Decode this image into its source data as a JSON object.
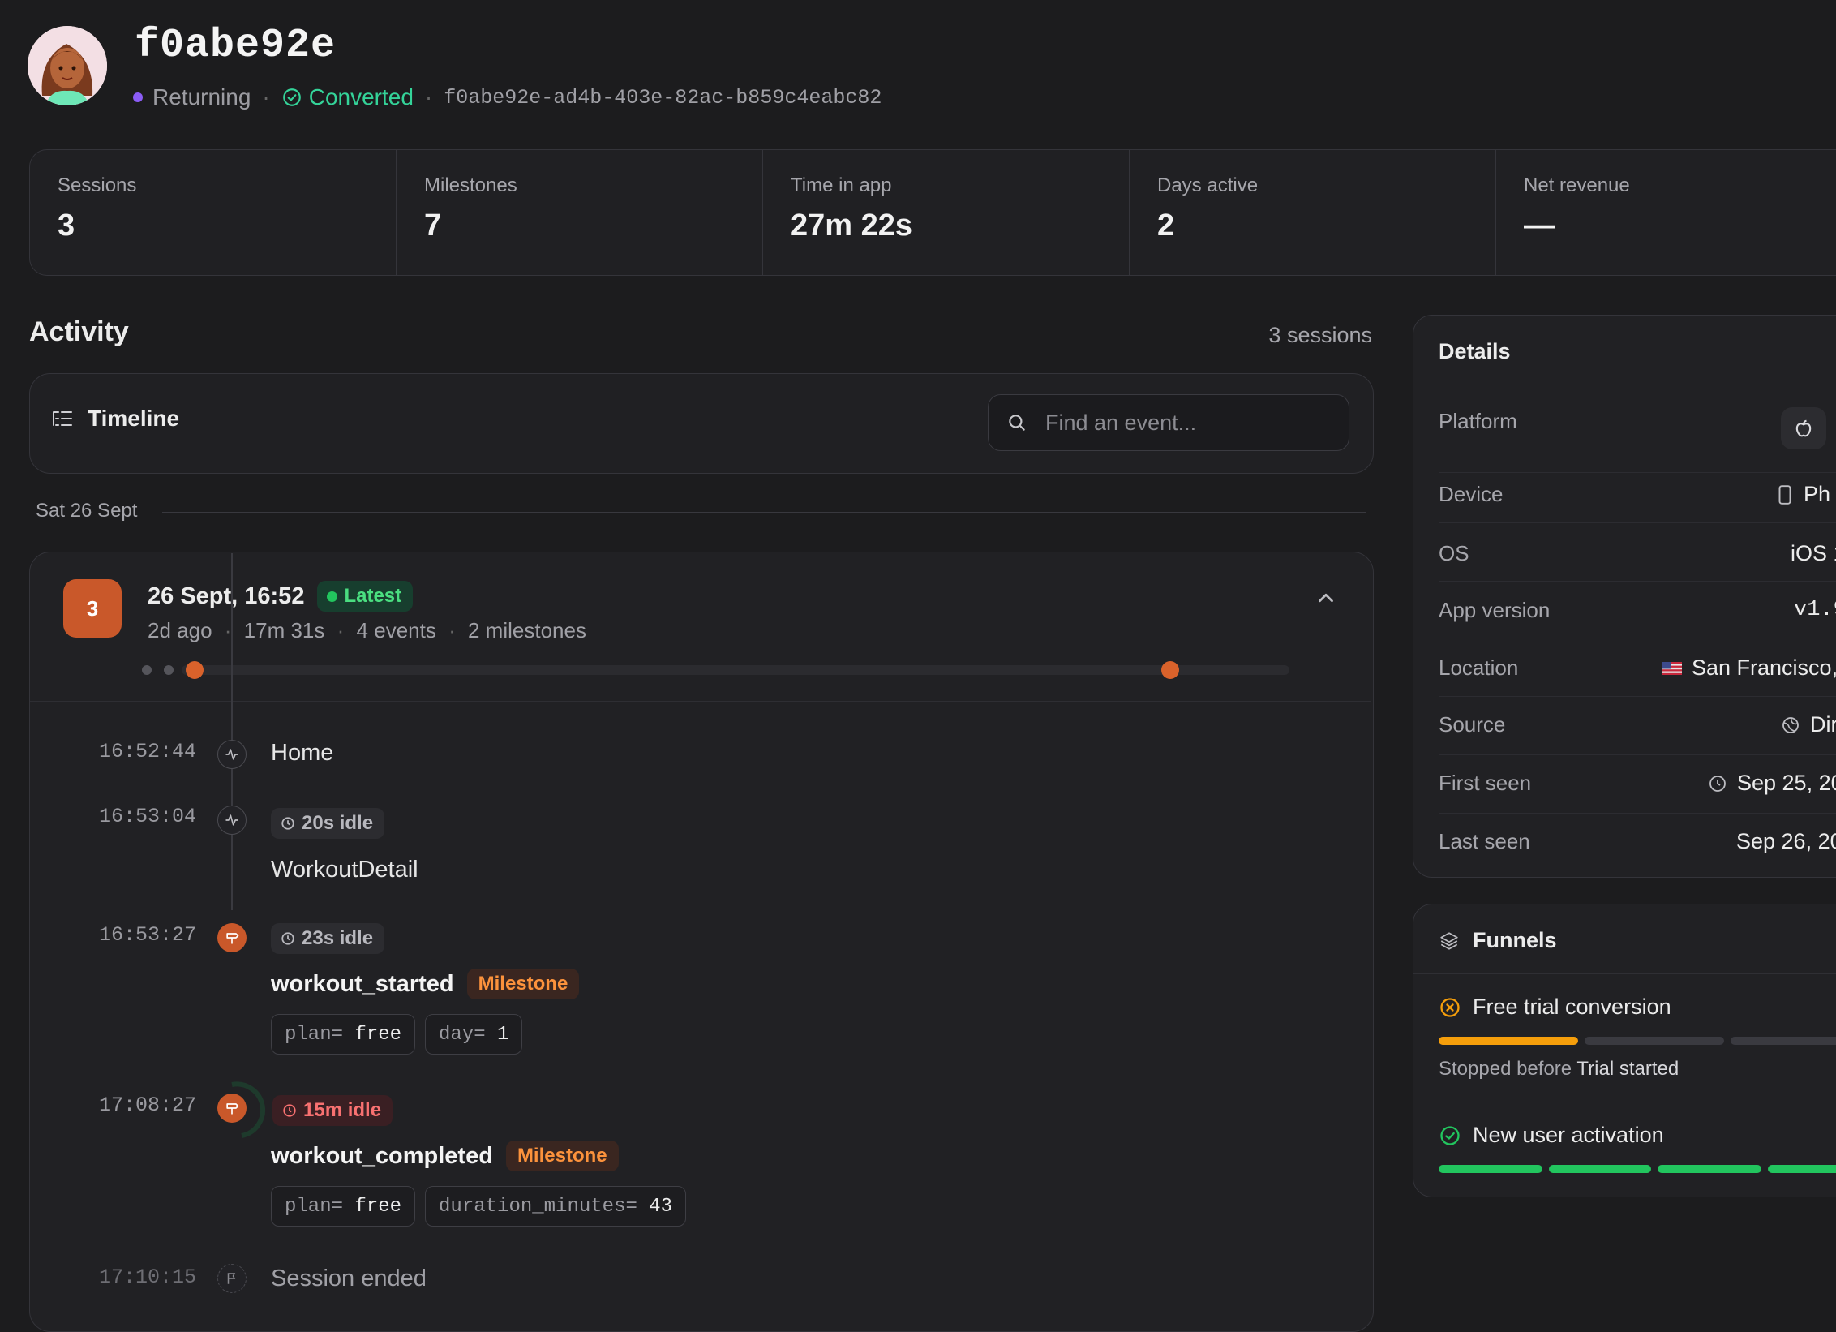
{
  "header": {
    "user_id": "f0abe92e",
    "status": "Returning",
    "conversion": "Converted",
    "uuid": "f0abe92e-ad4b-403e-82ac-b859c4eabc82",
    "status_dot_color": "#8b5cf6",
    "conversion_color": "#34d399"
  },
  "stats": [
    {
      "label": "Sessions",
      "value": "3"
    },
    {
      "label": "Milestones",
      "value": "7"
    },
    {
      "label": "Time in app",
      "value": "27m 22s"
    },
    {
      "label": "Days active",
      "value": "2"
    },
    {
      "label": "Net revenue",
      "value": "—"
    }
  ],
  "activity": {
    "title": "Activity",
    "sessions_count": "3 sessions",
    "timeline_label": "Timeline",
    "search_placeholder": "Find an event...",
    "date_label": "Sat 26 Sept"
  },
  "session": {
    "number": "3",
    "title": "26 Sept, 16:52",
    "badge": "Latest",
    "ago": "2d ago",
    "duration": "17m 31s",
    "events": "4 events",
    "milestones": "2 milestones",
    "accent": "#c9582a",
    "timeline": [
      {
        "time": "16:52:44",
        "name": "Home",
        "icon": "activity-icon"
      },
      {
        "time": "16:53:04",
        "idle": "20s idle",
        "name": "WorkoutDetail",
        "icon": "activity-icon"
      },
      {
        "time": "16:53:27",
        "idle": "23s idle",
        "name": "workout_started",
        "tag": "Milestone",
        "icon": "signpost-icon",
        "props": [
          {
            "k": "plan=",
            "v": "free"
          },
          {
            "k": "day=",
            "v": "1"
          }
        ]
      },
      {
        "time": "17:08:27",
        "idle": "15m idle",
        "name": "workout_completed",
        "tag": "Milestone",
        "icon": "signpost-icon",
        "props": [
          {
            "k": "plan=",
            "v": "free"
          },
          {
            "k": "duration_minutes=",
            "v": "43"
          }
        ]
      },
      {
        "time": "17:10:15",
        "name": "Session ended",
        "icon": "flag-icon"
      }
    ]
  },
  "details": {
    "title": "Details",
    "rows": [
      {
        "label": "Platform",
        "value": "",
        "icon": "apple-icon"
      },
      {
        "label": "Device",
        "value": "Ph",
        "icon": "phone-icon"
      },
      {
        "label": "OS",
        "value": "iOS 1"
      },
      {
        "label": "App version",
        "value": "v1.9"
      },
      {
        "label": "Location",
        "value": "San Francisco,",
        "icon": "us-flag-icon"
      },
      {
        "label": "Source",
        "value": "Dir",
        "icon": "globe-icon"
      },
      {
        "label": "First seen",
        "value": "Sep 25, 20",
        "icon": "clock-icon"
      },
      {
        "label": "Last seen",
        "value": "Sep 26, 20"
      }
    ]
  },
  "funnels": {
    "title": "Funnels",
    "items": [
      {
        "name": "Free trial conversion",
        "status": "stopped",
        "note_prefix": "Stopped before",
        "note_step": "Trial started",
        "color": "#f59e0b"
      },
      {
        "name": "New user activation",
        "status": "completed",
        "color": "#22c55e"
      }
    ]
  }
}
